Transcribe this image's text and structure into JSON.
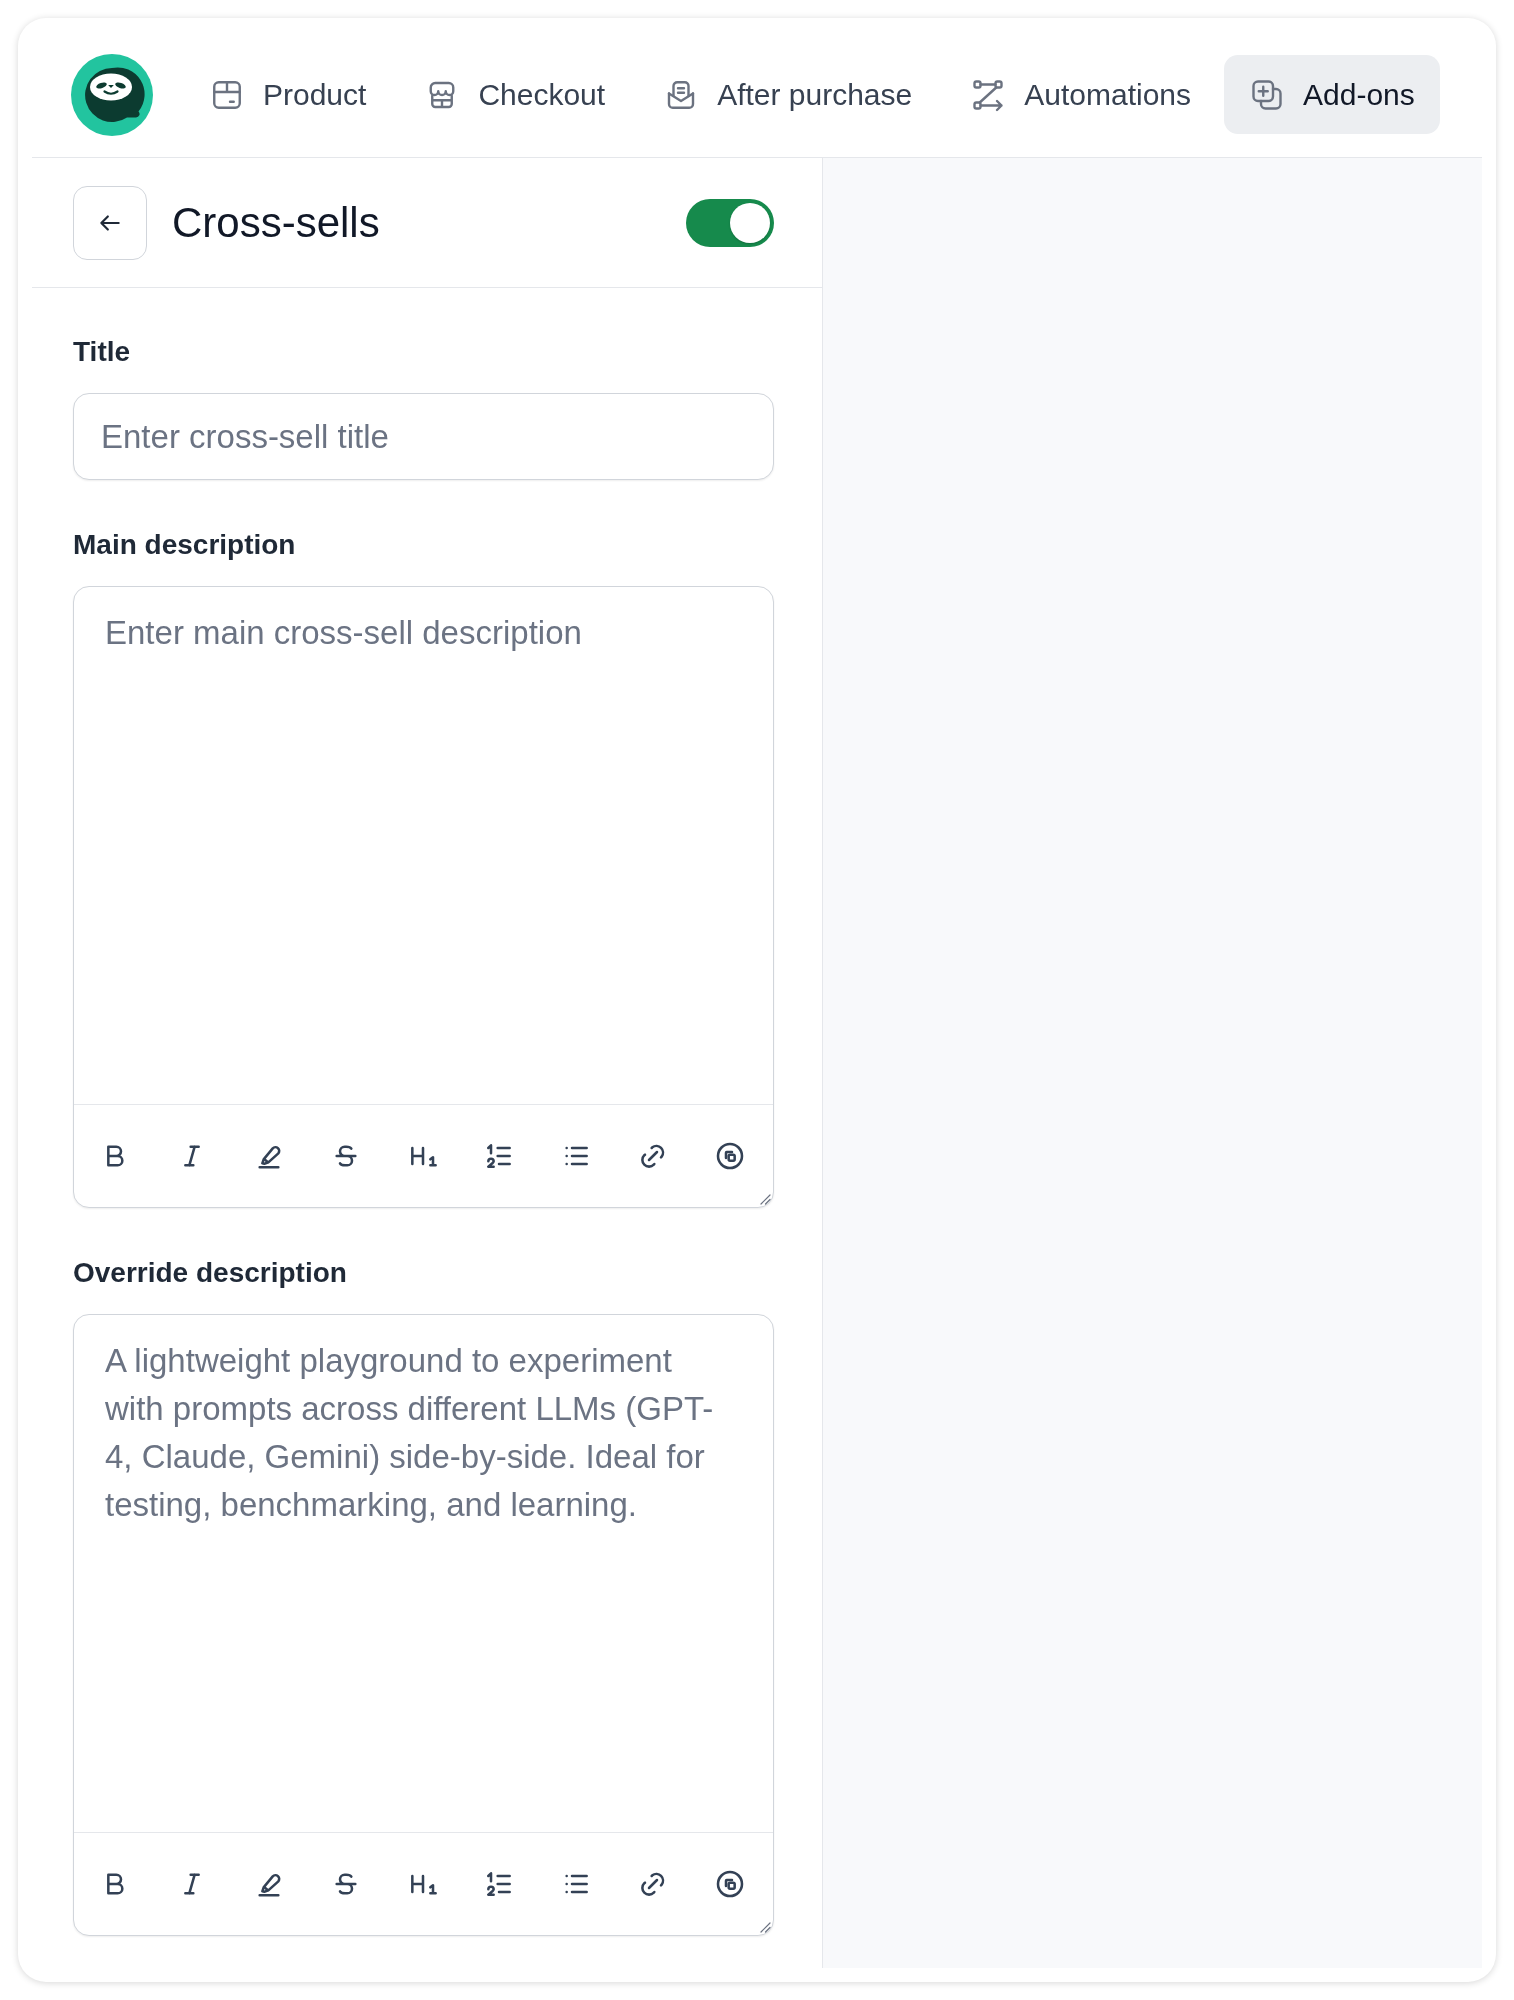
{
  "nav": {
    "items": [
      {
        "label": "Product",
        "selected": false
      },
      {
        "label": "Checkout",
        "selected": false
      },
      {
        "label": "After purchase",
        "selected": false
      },
      {
        "label": "Automations",
        "selected": false
      },
      {
        "label": "Add-ons",
        "selected": true
      }
    ]
  },
  "panel": {
    "title": "Cross-sells",
    "enabled": true
  },
  "fields": [
    {
      "kind": "input",
      "label": "Title",
      "placeholder": "Enter cross-sell title"
    },
    {
      "kind": "editor",
      "label": "Main description",
      "placeholder": "Enter main cross-sell description"
    },
    {
      "kind": "editor",
      "label": "Override description",
      "placeholder": "A lightweight playground to experiment with prompts across different LLMs (GPT-4, Claude, Gemini) side-by-side. Ideal for testing, benchmarking, and learning."
    }
  ]
}
